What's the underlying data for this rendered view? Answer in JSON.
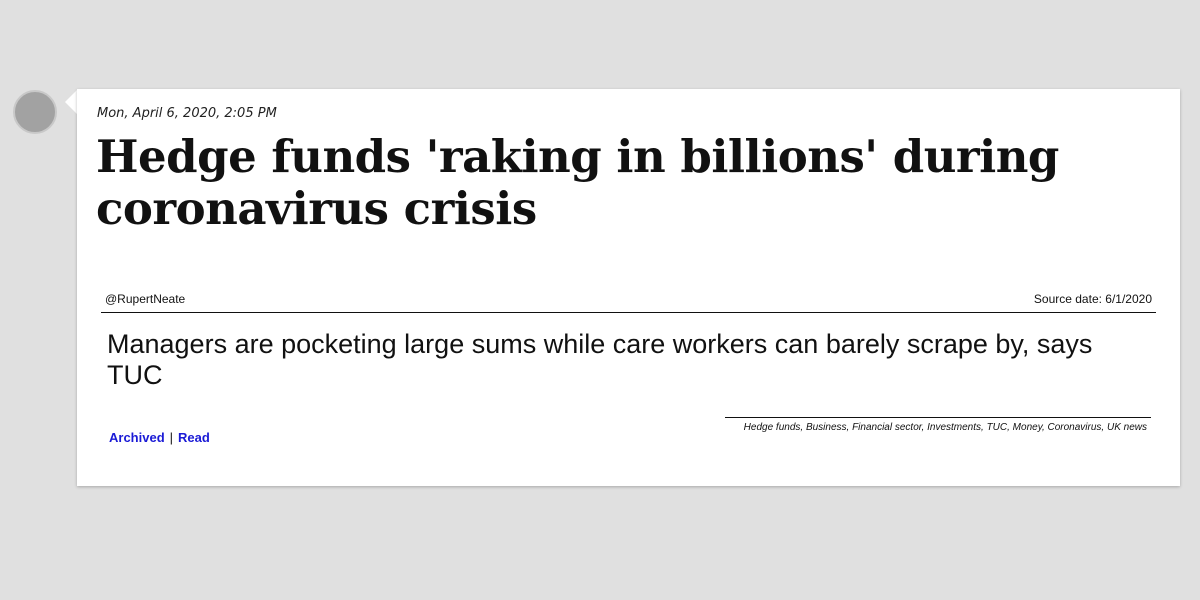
{
  "post": {
    "date": "Mon, April 6, 2020, 2:05 PM",
    "headline": "Hedge funds 'raking in billions' during coronavirus crisis",
    "author_handle": "@RupertNeate",
    "source_date": "Source date: 6/1/2020",
    "subtitle": "Managers are pocketing large sums while care workers can barely scrape by, says TUC",
    "tags": "Hedge funds, Business, Financial sector, Investments, TUC, Money, Coronavirus, UK news"
  },
  "links": {
    "archived_label": "Archived",
    "separator": "|",
    "read_label": "Read"
  }
}
